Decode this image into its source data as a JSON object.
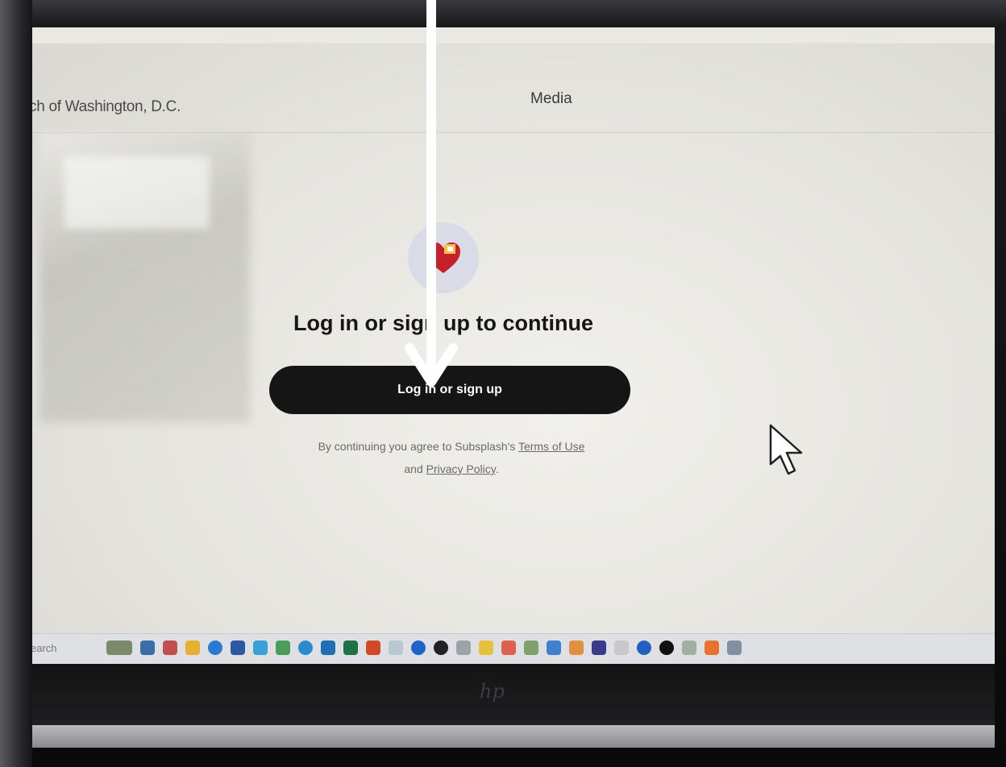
{
  "header": {
    "church_name": "ch of Washington, D.C.",
    "nav_media": "Media"
  },
  "login": {
    "heading": "Log in or sign up to continue",
    "button_label": "Log in or sign up",
    "legal_prefix": "By continuing you agree to Subsplash's ",
    "terms_link": "Terms of Use",
    "legal_and": "and ",
    "privacy_link": "Privacy Policy",
    "legal_suffix": "."
  },
  "taskbar": {
    "search_label": "earch"
  },
  "colors": {
    "button_bg": "#151515",
    "button_text": "#ffffff",
    "annotation_arrow": "#ffffff",
    "logo_heart": "#c8202b"
  },
  "icons": [
    "cursor-icon",
    "heart-logo-icon",
    "annotation-arrow-icon",
    "brand-logo-icon"
  ]
}
